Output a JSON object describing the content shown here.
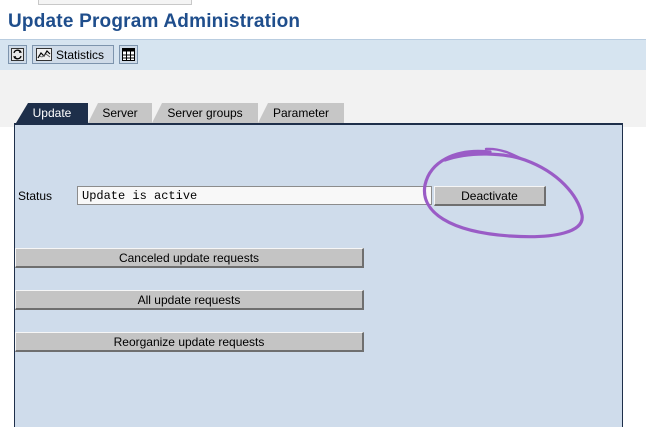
{
  "window": {
    "title": "Update Program Administration"
  },
  "toolbar": {
    "refresh_icon": "refresh-icon",
    "statistics_label": "Statistics",
    "statistics_icon": "chart-icon",
    "table_icon": "table-icon"
  },
  "tabs": [
    {
      "label": "Update",
      "active": true
    },
    {
      "label": "Server",
      "active": false
    },
    {
      "label": "Server groups",
      "active": false
    },
    {
      "label": "Parameter",
      "active": false
    }
  ],
  "status": {
    "label": "Status",
    "value": "Update is active"
  },
  "buttons": {
    "deactivate": "Deactivate",
    "canceled": "Canceled update requests",
    "all": "All update requests",
    "reorganize": "Reorganize update requests"
  },
  "colors": {
    "title": "#1f4e8c",
    "panel_bg": "#cfdceb",
    "active_tab": "#1e2f4a",
    "annotation": "#9a5cc6"
  }
}
